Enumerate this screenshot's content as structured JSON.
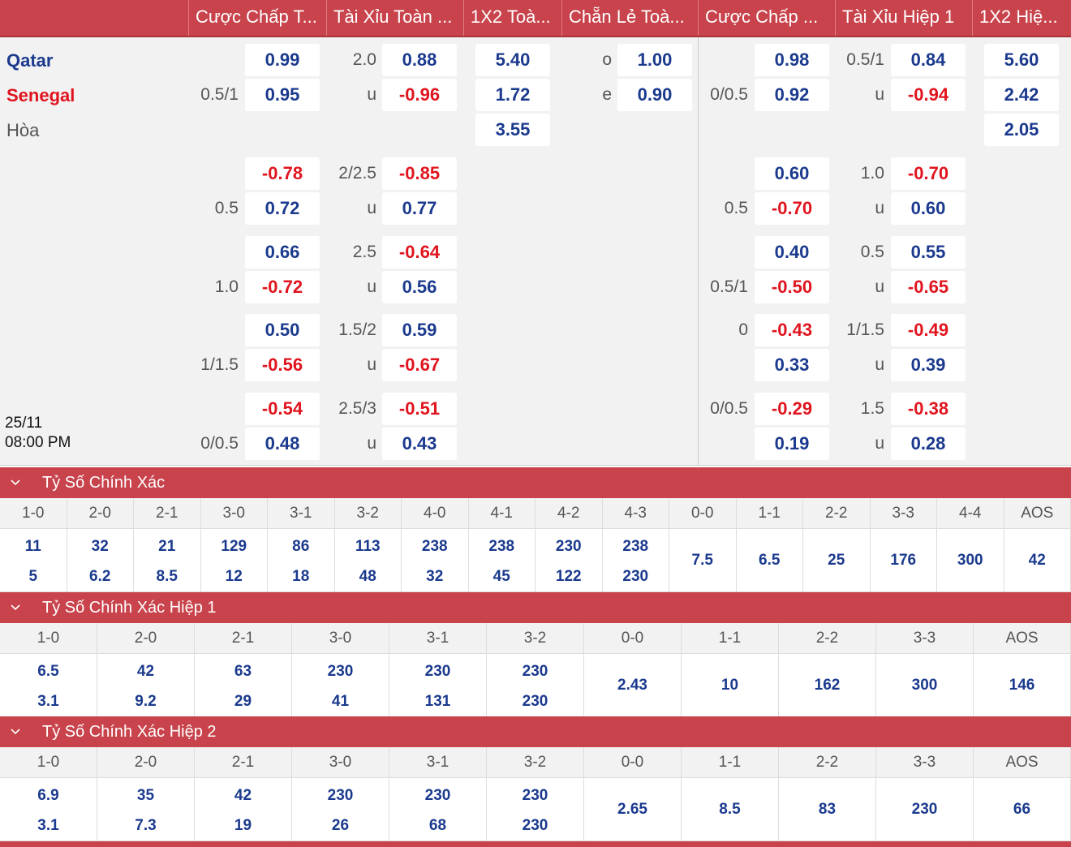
{
  "header": [
    "Cược Chấp T...",
    "Tài Xỉu Toàn ...",
    "1X2 Toà...",
    "Chẵn Lẻ Toà...",
    "Cược Chấp ...",
    "Tài Xỉu Hiệp 1",
    "1X2 Hiệ..."
  ],
  "teams": {
    "home": "Qatar",
    "away": "Senegal",
    "draw": "Hòa"
  },
  "colors": {
    "home": "#1b3a8e",
    "away": "#e0141e",
    "accent": "#c8434b"
  },
  "match_time": {
    "date": "25/11",
    "time": "08:00 PM"
  },
  "main": {
    "hcp": {
      "line": "0.5/1",
      "home": "0.99",
      "away": "0.95"
    },
    "ou": {
      "line": "2.0",
      "over": "0.88",
      "u": "u",
      "under": "-0.96"
    },
    "x12": {
      "home": "5.40",
      "away": "1.72",
      "draw": "3.55"
    },
    "oe": {
      "o": "o",
      "odd": "1.00",
      "e": "e",
      "even": "0.90"
    },
    "h1hcp": {
      "line": "0/0.5",
      "home": "0.98",
      "away": "0.92"
    },
    "h1ou": {
      "line": "0.5/1",
      "over": "0.84",
      "u": "u",
      "under": "-0.94"
    },
    "h1x12": {
      "home": "5.60",
      "away": "2.42",
      "draw": "2.05"
    }
  },
  "extra": [
    {
      "hcp_line": "0.5",
      "hcp_a": "-0.78",
      "hcp_b": "0.72",
      "ou_line": "2/2.5",
      "ou_a": "-0.85",
      "ou_u": "u",
      "ou_b": "0.77",
      "h1hcp_line": "0.5",
      "h1hcp_a": "0.60",
      "h1hcp_b": "-0.70",
      "h1ou_line": "1.0",
      "h1ou_a": "-0.70",
      "h1ou_u": "u",
      "h1ou_b": "0.60"
    },
    {
      "hcp_line": "1.0",
      "hcp_a": "0.66",
      "hcp_b": "-0.72",
      "ou_line": "2.5",
      "ou_a": "-0.64",
      "ou_u": "u",
      "ou_b": "0.56",
      "h1hcp_line": "0.5/1",
      "h1hcp_a": "0.40",
      "h1hcp_b": "-0.50",
      "h1ou_line": "0.5",
      "h1ou_a": "0.55",
      "h1ou_u": "u",
      "h1ou_b": "-0.65"
    },
    {
      "hcp_line": "1/1.5",
      "hcp_a": "0.50",
      "hcp_b": "-0.56",
      "ou_line": "1.5/2",
      "ou_a": "0.59",
      "ou_u": "u",
      "ou_b": "-0.67",
      "h1hcp_line": "0",
      "h1hcp_a": "-0.43",
      "h1hcp_b": "0.33",
      "h1ou_line": "1/1.5",
      "h1ou_a": "-0.49",
      "h1ou_u": "u",
      "h1ou_b": "0.39"
    },
    {
      "hcp_line": "0/0.5",
      "hcp_a": "-0.54",
      "hcp_b": "0.48",
      "ou_line": "2.5/3",
      "ou_a": "-0.51",
      "ou_u": "u",
      "ou_b": "0.43",
      "h1hcp_line": "0/0.5",
      "h1hcp_a": "-0.29",
      "h1hcp_b": "0.19",
      "h1ou_line": "1.5",
      "h1ou_a": "-0.38",
      "h1ou_u": "u",
      "h1ou_b": "0.28"
    }
  ],
  "sections": [
    {
      "title": "Tỷ Số Chính Xác",
      "icon": "chevron-down-icon",
      "columns": [
        "1-0",
        "2-0",
        "2-1",
        "3-0",
        "3-1",
        "3-2",
        "4-0",
        "4-1",
        "4-2",
        "4-3",
        "0-0",
        "1-1",
        "2-2",
        "3-3",
        "4-4",
        "AOS"
      ],
      "home": [
        "11",
        "32",
        "21",
        "129",
        "86",
        "113",
        "238",
        "238",
        "230",
        "238"
      ],
      "away": [
        "5",
        "6.2",
        "8.5",
        "12",
        "18",
        "48",
        "32",
        "45",
        "122",
        "230"
      ],
      "single": [
        "7.5",
        "6.5",
        "25",
        "176",
        "300",
        "42"
      ]
    },
    {
      "title": "Tỷ Số Chính Xác Hiệp 1",
      "icon": "chevron-down-icon",
      "columns": [
        "1-0",
        "2-0",
        "2-1",
        "3-0",
        "3-1",
        "3-2",
        "0-0",
        "1-1",
        "2-2",
        "3-3",
        "AOS"
      ],
      "home": [
        "6.5",
        "42",
        "63",
        "230",
        "230",
        "230"
      ],
      "away": [
        "3.1",
        "9.2",
        "29",
        "41",
        "131",
        "230"
      ],
      "single": [
        "2.43",
        "10",
        "162",
        "300",
        "146"
      ]
    },
    {
      "title": "Tỷ Số Chính Xác Hiệp 2",
      "icon": "chevron-down-icon",
      "columns": [
        "1-0",
        "2-0",
        "2-1",
        "3-0",
        "3-1",
        "3-2",
        "0-0",
        "1-1",
        "2-2",
        "3-3",
        "AOS"
      ],
      "home": [
        "6.9",
        "35",
        "42",
        "230",
        "230",
        "230"
      ],
      "away": [
        "3.1",
        "7.3",
        "19",
        "26",
        "68",
        "230"
      ],
      "single": [
        "2.65",
        "8.5",
        "83",
        "230",
        "66"
      ]
    }
  ]
}
